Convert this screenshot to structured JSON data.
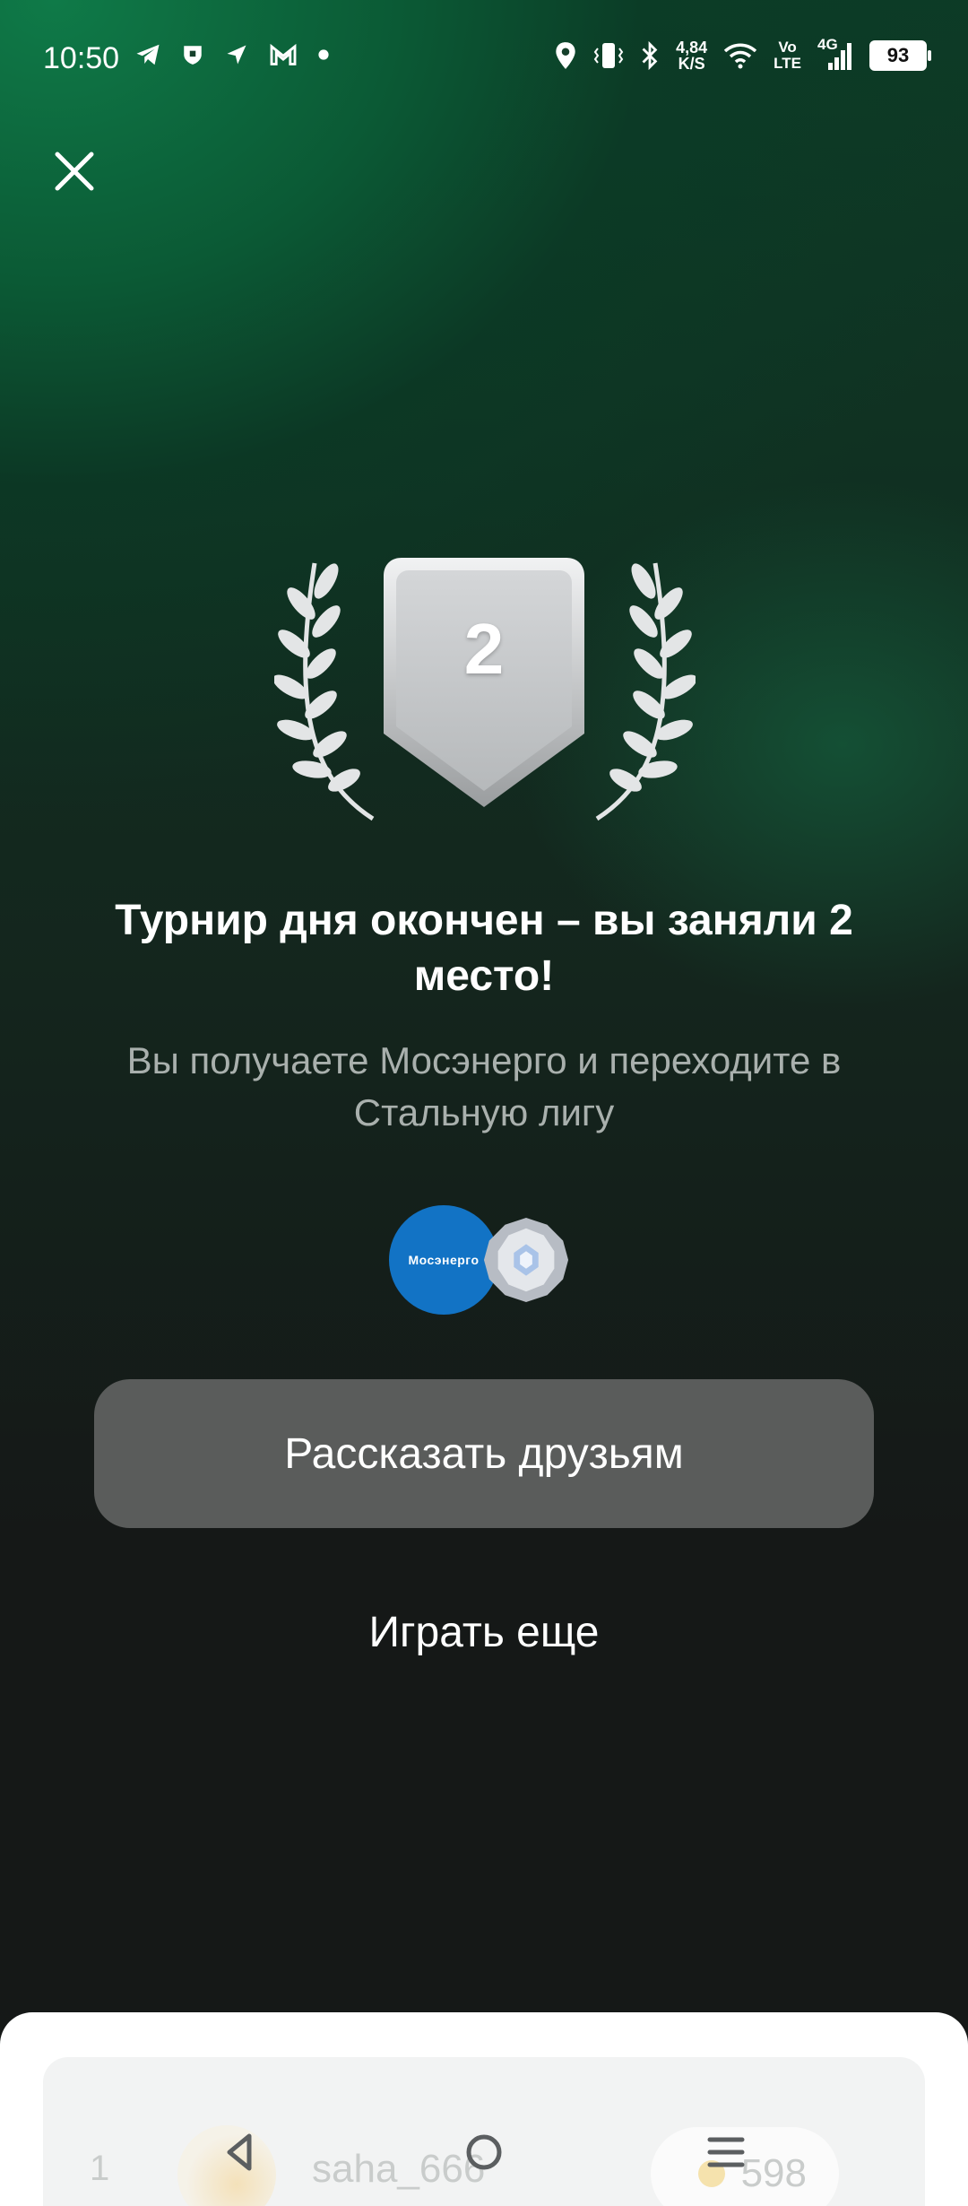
{
  "status_bar": {
    "time": "10:50",
    "net_speed_value": "4,84",
    "net_speed_unit": "K/S",
    "volte_top": "Vo",
    "volte_bottom": "LTE",
    "network": "4G",
    "battery": "93",
    "icons": [
      "telegram-icon",
      "shield-icon",
      "location-arrow-icon",
      "gmail-icon",
      "dot-icon",
      "location-pin-icon",
      "vibrate-icon",
      "bluetooth-icon",
      "wifi-icon",
      "signal-icon",
      "battery-icon"
    ]
  },
  "result": {
    "place": "2",
    "title": "Турнир дня окончен – вы заняли 2 место!",
    "subtitle": "Вы получаете Мосэнерго и переходите в Стальную лигу",
    "reward_logo_text": "Мосэнерго",
    "league_badge": "steel-league-icon"
  },
  "actions": {
    "share_label": "Рассказать друзьям",
    "play_again_label": "Играть еще"
  },
  "leaderboard": {
    "rows": [
      {
        "rank": "1",
        "username": "saha_666",
        "score": "598"
      }
    ]
  },
  "colors": {
    "accent_green": "#0f7a48",
    "button_gray": "#5a5c5b",
    "mosenergo_blue": "#1273c5",
    "medal_silver": "#c8cacb"
  }
}
